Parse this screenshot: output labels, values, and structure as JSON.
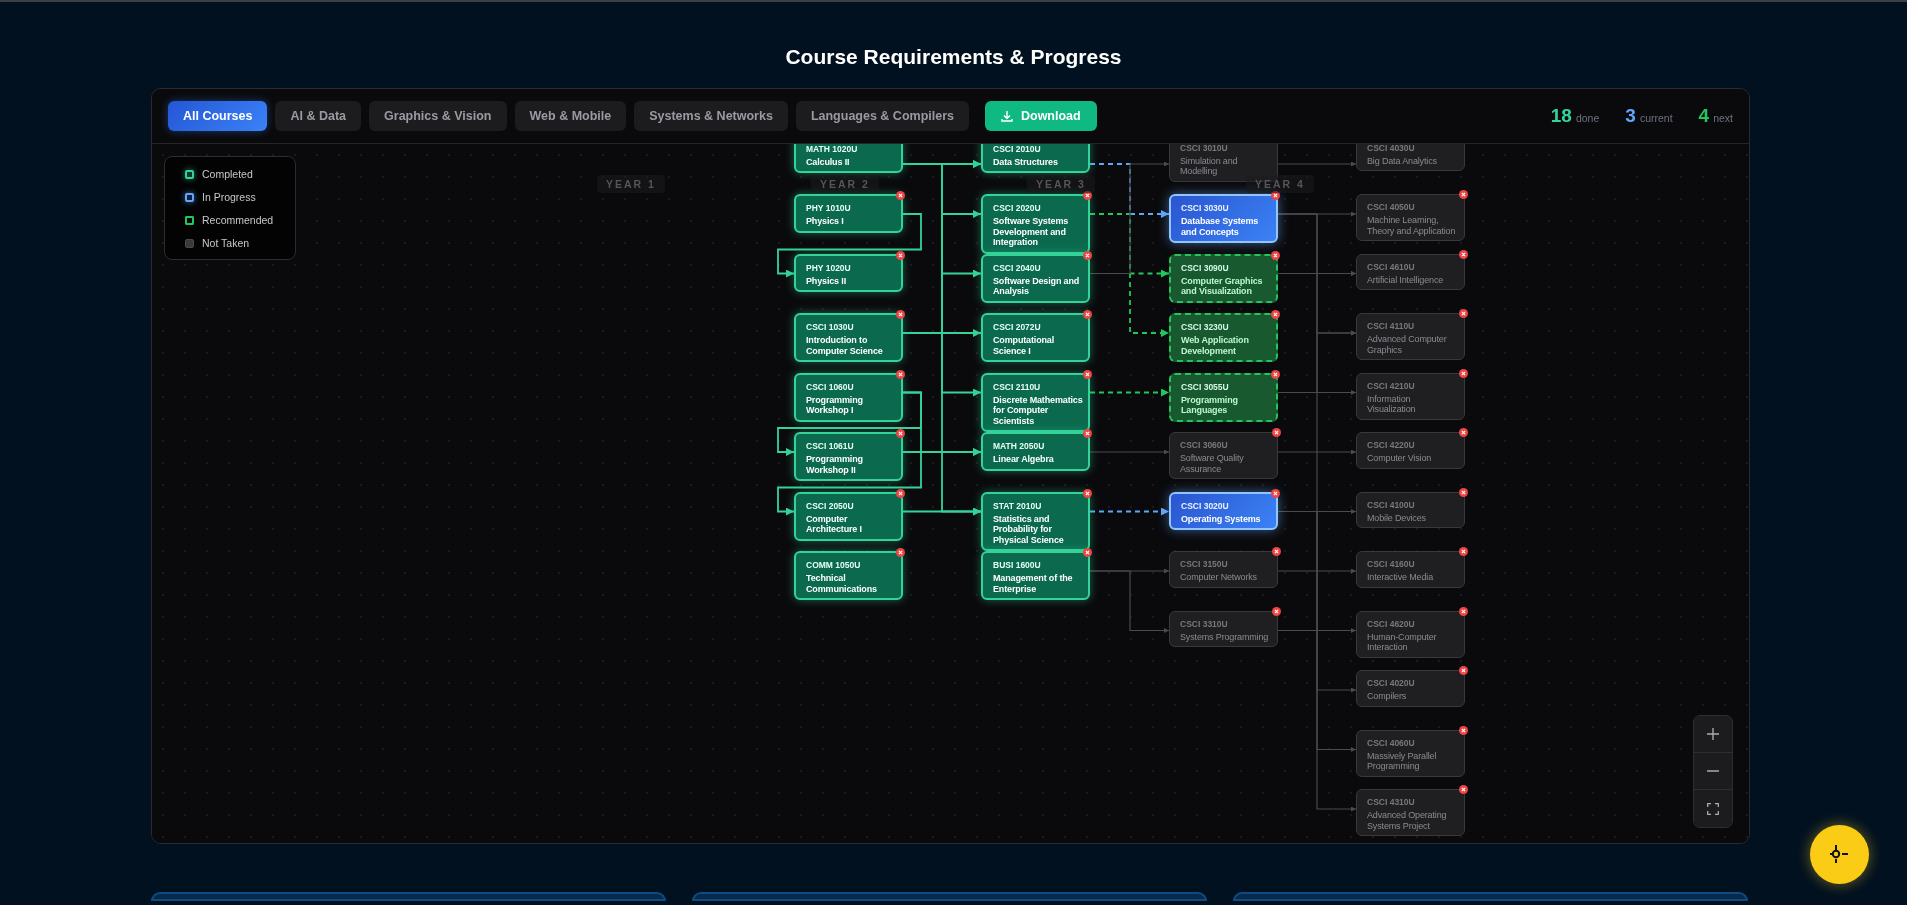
{
  "title": "Course Requirements & Progress",
  "tabs": [
    {
      "label": "All Courses",
      "selected": true
    },
    {
      "label": "AI & Data",
      "selected": false
    },
    {
      "label": "Graphics & Vision",
      "selected": false
    },
    {
      "label": "Web & Mobile",
      "selected": false
    },
    {
      "label": "Systems & Networks",
      "selected": false
    },
    {
      "label": "Languages & Compilers",
      "selected": false
    }
  ],
  "download": {
    "label": "Download"
  },
  "stats": [
    {
      "value": "18",
      "label": "done",
      "kind": "done"
    },
    {
      "value": "3",
      "label": "current",
      "kind": "current"
    },
    {
      "value": "4",
      "label": "next",
      "kind": "next"
    }
  ],
  "legend": [
    {
      "label": "Completed",
      "kind": "completed"
    },
    {
      "label": "In Progress",
      "kind": "in_progress"
    },
    {
      "label": "Recommended",
      "kind": "recommended"
    },
    {
      "label": "Not Taken",
      "kind": "not_taken"
    }
  ],
  "year_labels": [
    "YEAR 1",
    "YEAR 2",
    "YEAR 3",
    "YEAR 4"
  ],
  "columns": [
    {
      "courses": [
        {
          "code": "MATH 1020U",
          "name": "Calculus II",
          "kind": "completed"
        },
        {
          "code": "PHY 1010U",
          "name": "Physics I",
          "kind": "completed"
        },
        {
          "code": "PHY 1020U",
          "name": "Physics II",
          "kind": "completed"
        },
        {
          "code": "CSCI 1030U",
          "name": "Introduction to Computer Science",
          "kind": "completed"
        },
        {
          "code": "CSCI 1060U",
          "name": "Programming Workshop I",
          "kind": "completed"
        },
        {
          "code": "CSCI 1061U",
          "name": "Programming Workshop II",
          "kind": "completed"
        },
        {
          "code": "CSCI 2050U",
          "name": "Computer Architecture I",
          "kind": "completed"
        },
        {
          "code": "COMM 1050U",
          "name": "Technical Communications",
          "kind": "completed"
        }
      ]
    },
    {
      "courses": [
        {
          "code": "CSCI 2010U",
          "name": "Data Structures",
          "kind": "completed"
        },
        {
          "code": "CSCI 2020U",
          "name": "Software Systems Development and Integration",
          "kind": "completed"
        },
        {
          "code": "CSCI 2040U",
          "name": "Software Design and Analysis",
          "kind": "completed"
        },
        {
          "code": "CSCI 2072U",
          "name": "Computational Science I",
          "kind": "completed"
        },
        {
          "code": "CSCI 2110U",
          "name": "Discrete Mathematics for Computer Scientists",
          "kind": "completed"
        },
        {
          "code": "MATH 2050U",
          "name": "Linear Algebra",
          "kind": "completed"
        },
        {
          "code": "STAT 2010U",
          "name": "Statistics and Probability for Physical Science",
          "kind": "completed"
        },
        {
          "code": "BUSI 1600U",
          "name": "Management of the Enterprise",
          "kind": "completed"
        }
      ]
    },
    {
      "courses": [
        {
          "code": "CSCI 3010U",
          "name": "Simulation and Modelling",
          "kind": "not_taken"
        },
        {
          "code": "CSCI 3030U",
          "name": "Database Systems and Concepts",
          "kind": "in_progress"
        },
        {
          "code": "CSCI 3090U",
          "name": "Computer Graphics and Visualization",
          "kind": "recommended"
        },
        {
          "code": "CSCI 3230U",
          "name": "Web Application Development",
          "kind": "recommended"
        },
        {
          "code": "CSCI 3055U",
          "name": "Programming Languages",
          "kind": "recommended"
        },
        {
          "code": "CSCI 3060U",
          "name": "Software Quality Assurance",
          "kind": "not_taken"
        },
        {
          "code": "CSCI 3020U",
          "name": "Operating Systems",
          "kind": "in_progress"
        },
        {
          "code": "CSCI 3150U",
          "name": "Computer Networks",
          "kind": "not_taken"
        },
        {
          "code": "CSCI 3310U",
          "name": "Systems Programming",
          "kind": "not_taken"
        }
      ]
    },
    {
      "courses": [
        {
          "code": "CSCI 4030U",
          "name": "Big Data Analytics",
          "kind": "not_taken"
        },
        {
          "code": "CSCI 4050U",
          "name": "Machine Learning, Theory and Application",
          "kind": "not_taken"
        },
        {
          "code": "CSCI 4610U",
          "name": "Artificial Intelligence",
          "kind": "not_taken"
        },
        {
          "code": "CSCI 4110U",
          "name": "Advanced Computer Graphics",
          "kind": "not_taken"
        },
        {
          "code": "CSCI 4210U",
          "name": "Information Visualization",
          "kind": "not_taken"
        },
        {
          "code": "CSCI 4220U",
          "name": "Computer Vision",
          "kind": "not_taken"
        },
        {
          "code": "CSCI 4100U",
          "name": "Mobile Devices",
          "kind": "not_taken"
        },
        {
          "code": "CSCI 4160U",
          "name": "Interactive Media",
          "kind": "not_taken"
        },
        {
          "code": "CSCI 4620U",
          "name": "Human-Computer Interaction",
          "kind": "not_taken"
        },
        {
          "code": "CSCI 4020U",
          "name": "Compilers",
          "kind": "not_taken"
        },
        {
          "code": "CSCI 4060U",
          "name": "Massively Parallel Programming",
          "kind": "not_taken"
        },
        {
          "code": "CSCI 4310U",
          "name": "Advanced Operating Systems Project",
          "kind": "not_taken"
        }
      ]
    }
  ]
}
